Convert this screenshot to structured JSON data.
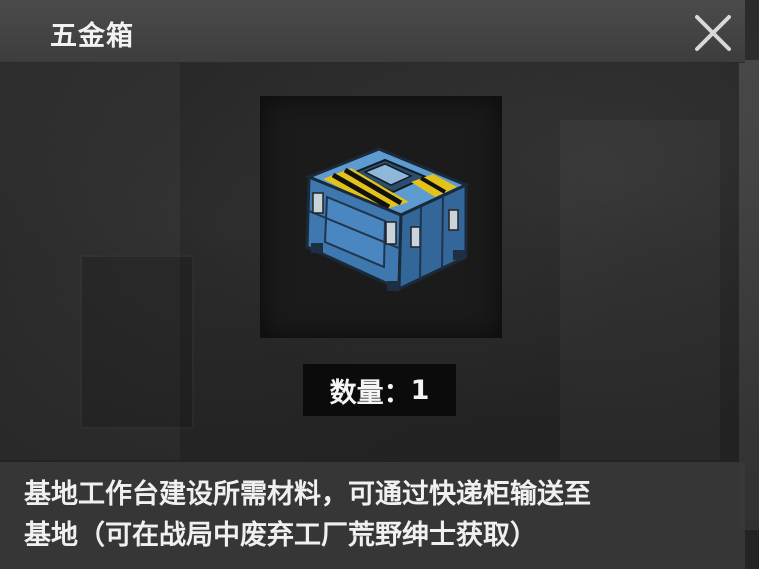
{
  "dialog": {
    "title": "五金箱",
    "close_icon": "close-icon"
  },
  "item": {
    "icon": "toolbox-icon",
    "quantity_label": "数量：",
    "quantity_value": "1"
  },
  "description": {
    "line1": "基地工作台建设所需材料，可通过快递柜输送至",
    "line2": "基地（可在战局中废弃工厂荒野绅士获取）"
  },
  "colors": {
    "header_bg": "#444444",
    "crate_blue": "#4a86bf",
    "stripe_yellow": "#e3c21a"
  }
}
